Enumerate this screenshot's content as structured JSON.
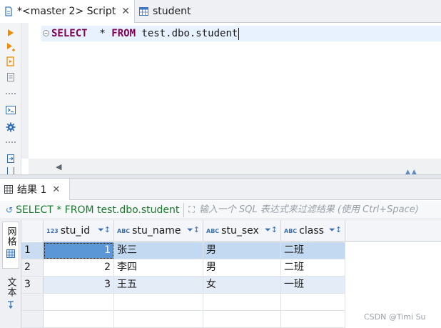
{
  "tabs": [
    {
      "label": "*<master 2> Script",
      "close": "✕",
      "active": true
    },
    {
      "label": "student",
      "active": false
    }
  ],
  "editor": {
    "sql": {
      "kw_select": "SELECT",
      "star": "  * ",
      "kw_from": "FROM",
      "target": " test.dbo.student"
    }
  },
  "results": {
    "tab_label": "结果 1",
    "tab_close": "✕",
    "filter": {
      "query_text": "SELECT * FROM test.dbo.student",
      "placeholder": "输入一个 SQL 表达式来过滤结果 (使用 Ctrl+Space)"
    },
    "side_tabs": {
      "grid": "网格",
      "text": "文本"
    },
    "columns": [
      {
        "type": "123",
        "name": "stu_id"
      },
      {
        "type": "ABC",
        "name": "stu_name"
      },
      {
        "type": "ABC",
        "name": "stu_sex"
      },
      {
        "type": "ABC",
        "name": "class"
      }
    ],
    "rows": [
      {
        "n": "1",
        "stu_id": "1",
        "stu_name": "张三",
        "stu_sex": "男",
        "class": "二班"
      },
      {
        "n": "2",
        "stu_id": "2",
        "stu_name": "李四",
        "stu_sex": "男",
        "class": "二班"
      },
      {
        "n": "3",
        "stu_id": "3",
        "stu_name": "王五",
        "stu_sex": "女",
        "class": "一班"
      }
    ]
  },
  "watermark": "CSDN @Timi Su",
  "colors": {
    "keyword": "#7f0055",
    "query_green": "#1a7a2d",
    "selection": "#c3d9f2",
    "focus": "#5b96d6"
  }
}
